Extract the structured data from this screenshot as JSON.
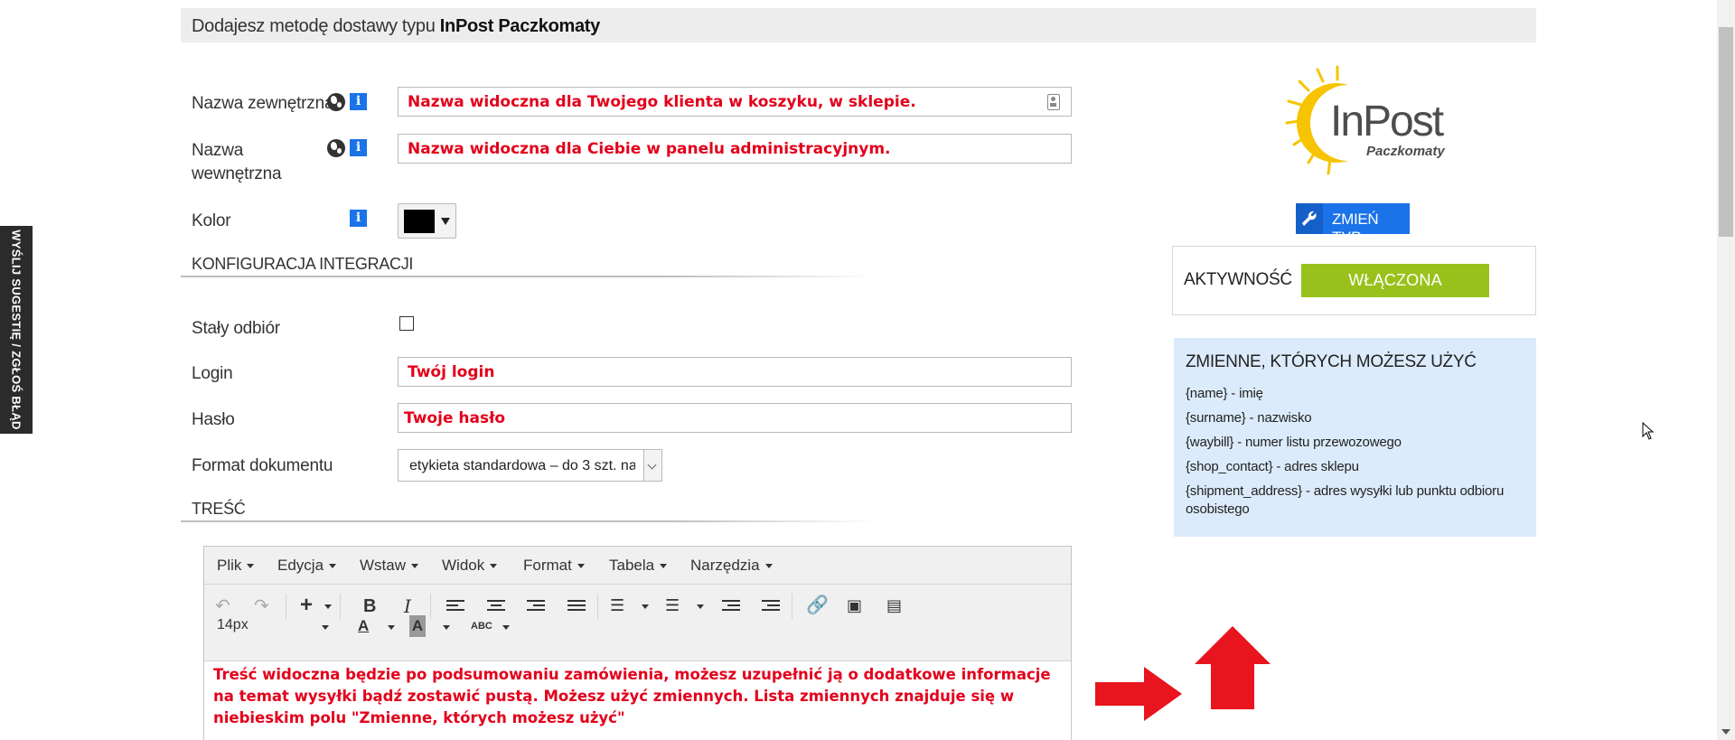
{
  "feedback_tab": {
    "label": "WYŚLIJ SUGESTIĘ / ZGŁOŚ BŁĄD"
  },
  "header": {
    "prefix": "Dodajesz metodę dostawy typu ",
    "type_name": "InPost Paczkomaty"
  },
  "form": {
    "external_name": {
      "label": "Nazwa zewnętrzna",
      "placeholder": "Nazwa widoczna dla Twojego klienta w koszyku, w sklepie."
    },
    "internal_name": {
      "label_line1": "Nazwa",
      "label_line2": "wewnętrzna",
      "placeholder": "Nazwa widoczna dla Ciebie w panelu administracyjnym."
    },
    "color": {
      "label": "Kolor",
      "value": "#000000"
    },
    "integration_section": {
      "title": "KONFIGURACJA INTEGRACJI"
    },
    "permanent_pickup": {
      "label": "Stały odbiór",
      "checked": false
    },
    "login": {
      "label": "Login",
      "placeholder": "Twój login"
    },
    "password": {
      "label": "Hasło",
      "placeholder": "Twoje hasło"
    },
    "document_format": {
      "label": "Format dokumentu",
      "selected": "etykieta standardowa – do 3 szt. na"
    },
    "content_section": {
      "title": "TREŚĆ"
    }
  },
  "editor": {
    "menu": [
      "Plik",
      "Edycja",
      "Wstaw",
      "Widok",
      "Format",
      "Tabela",
      "Narzędzia"
    ],
    "font_size": "14px",
    "body_text": "Treść widoczna będzie po podsumowaniu zamówienia, możesz uzupełnić ją o dodatkowe informacje na temat wysyłki bądź zostawić pustą. Możesz użyć zmiennych. Lista zmiennych znajduje się w niebieskim polu \"Zmienne, których możesz użyć\""
  },
  "sidebar": {
    "logo": {
      "brand": "InPost",
      "sub": "Paczkomaty"
    },
    "change_type_label": "ZMIEŃ TYP",
    "activity": {
      "label": "AKTYWNOŚĆ",
      "state": "WŁĄCZONA"
    },
    "variables": {
      "title": "ZMIENNE, KTÓRYCH MOŻESZ UŻYĆ",
      "items": [
        "{name} - imię",
        "{surname} - nazwisko",
        "{waybill} - numer listu przewozowego",
        "{shop_contact} - adres sklepu",
        "{shipment_address} - adres wysyłki lub punktu odbioru osobistego"
      ]
    }
  },
  "colors": {
    "accent_blue": "#1a73e8",
    "active_green": "#98c21b",
    "placeholder_red": "#e3001b",
    "variables_bg": "#dcebfb",
    "logo_yellow": "#f6c400"
  }
}
